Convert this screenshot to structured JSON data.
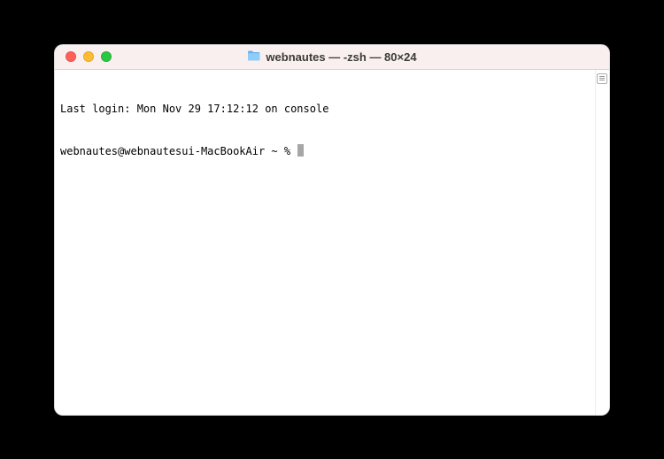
{
  "window": {
    "title": "webnautes — -zsh — 80×24"
  },
  "terminal": {
    "last_login_line": "Last login: Mon Nov 29 17:12:12 on console",
    "prompt": "webnautes@webnautesui-MacBookAir ~ % "
  }
}
